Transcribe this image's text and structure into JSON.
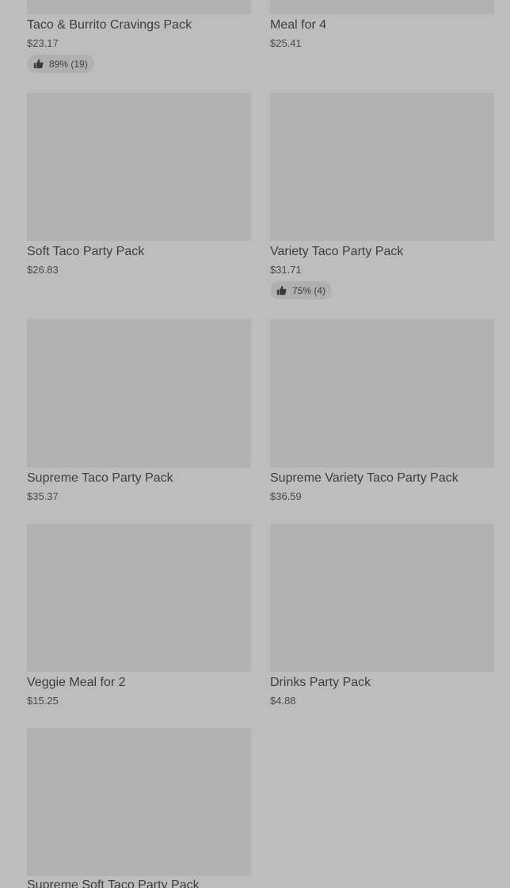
{
  "items": [
    {
      "name": "Taco & Burrito Cravings Pack",
      "price": "$23.17",
      "rating": "89% (19)"
    },
    {
      "name": "Meal for 4",
      "price": "$25.41"
    },
    {
      "name": "Soft Taco Party Pack",
      "price": "$26.83"
    },
    {
      "name": "Variety Taco Party Pack",
      "price": "$31.71",
      "rating": "75% (4)"
    },
    {
      "name": "Supreme Taco Party Pack",
      "price": "$35.37"
    },
    {
      "name": "Supreme Variety Taco Party Pack",
      "price": "$36.59"
    },
    {
      "name": "Veggie Meal for 2",
      "price": "$15.25"
    },
    {
      "name": "Drinks Party Pack",
      "price": "$4.88"
    },
    {
      "name": "Supreme Soft Taco Party Pack"
    }
  ],
  "icons": {
    "rating": "thumbs-up-icon"
  }
}
